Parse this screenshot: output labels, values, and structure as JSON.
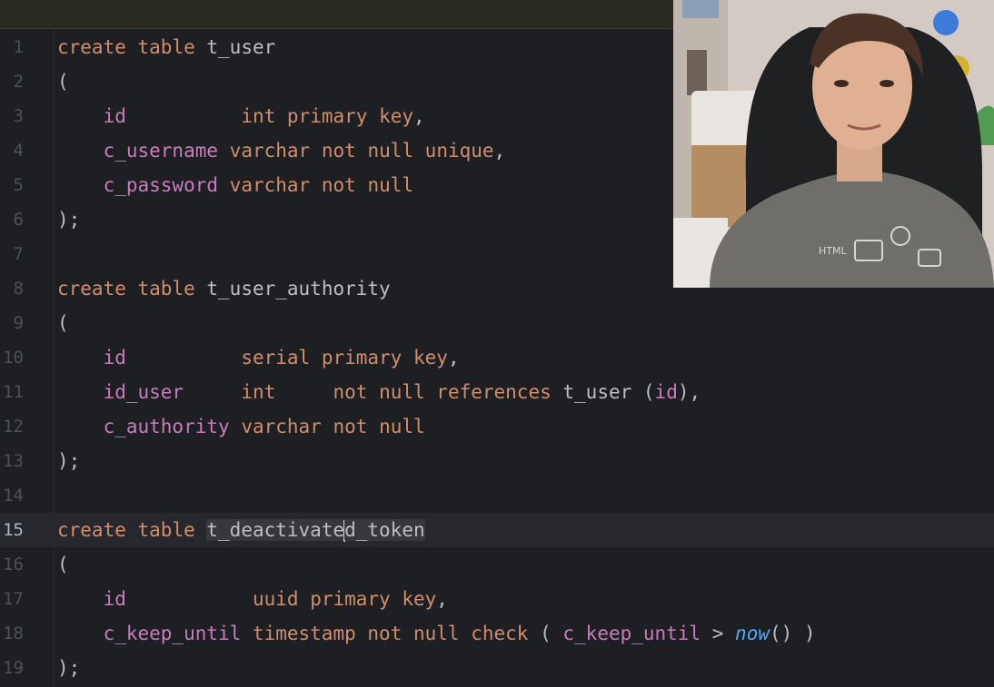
{
  "editor": {
    "current_line": 15,
    "lines": [
      {
        "n": "1",
        "tokens": [
          [
            "kw",
            "create"
          ],
          [
            "pun",
            " "
          ],
          [
            "kw",
            "table"
          ],
          [
            "pun",
            " "
          ],
          [
            "ident",
            "t_user"
          ]
        ]
      },
      {
        "n": "2",
        "tokens": [
          [
            "pun",
            "("
          ]
        ]
      },
      {
        "n": "3",
        "tokens": [
          [
            "pun",
            "    "
          ],
          [
            "fld",
            "id"
          ],
          [
            "pun",
            "          "
          ],
          [
            "kw",
            "int"
          ],
          [
            "pun",
            " "
          ],
          [
            "kw",
            "primary"
          ],
          [
            "pun",
            " "
          ],
          [
            "kw",
            "key"
          ],
          [
            "pun",
            ","
          ]
        ]
      },
      {
        "n": "4",
        "tokens": [
          [
            "pun",
            "    "
          ],
          [
            "fld",
            "c_username"
          ],
          [
            "pun",
            " "
          ],
          [
            "kw",
            "varchar"
          ],
          [
            "pun",
            " "
          ],
          [
            "kw",
            "not"
          ],
          [
            "pun",
            " "
          ],
          [
            "kw",
            "null"
          ],
          [
            "pun",
            " "
          ],
          [
            "kw",
            "unique"
          ],
          [
            "pun",
            ","
          ]
        ]
      },
      {
        "n": "5",
        "tokens": [
          [
            "pun",
            "    "
          ],
          [
            "fld",
            "c_password"
          ],
          [
            "pun",
            " "
          ],
          [
            "kw",
            "varchar"
          ],
          [
            "pun",
            " "
          ],
          [
            "kw",
            "not"
          ],
          [
            "pun",
            " "
          ],
          [
            "kw",
            "null"
          ]
        ]
      },
      {
        "n": "6",
        "tokens": [
          [
            "pun",
            ");"
          ]
        ]
      },
      {
        "n": "7",
        "tokens": []
      },
      {
        "n": "8",
        "tokens": [
          [
            "kw",
            "create"
          ],
          [
            "pun",
            " "
          ],
          [
            "kw",
            "table"
          ],
          [
            "pun",
            " "
          ],
          [
            "ident",
            "t_user_authority"
          ]
        ]
      },
      {
        "n": "9",
        "tokens": [
          [
            "pun",
            "("
          ]
        ]
      },
      {
        "n": "10",
        "tokens": [
          [
            "pun",
            "    "
          ],
          [
            "fld",
            "id"
          ],
          [
            "pun",
            "          "
          ],
          [
            "kw",
            "serial"
          ],
          [
            "pun",
            " "
          ],
          [
            "kw",
            "primary"
          ],
          [
            "pun",
            " "
          ],
          [
            "kw",
            "key"
          ],
          [
            "pun",
            ","
          ]
        ]
      },
      {
        "n": "11",
        "tokens": [
          [
            "pun",
            "    "
          ],
          [
            "fld",
            "id_user"
          ],
          [
            "pun",
            "     "
          ],
          [
            "kw",
            "int"
          ],
          [
            "pun",
            "     "
          ],
          [
            "kw",
            "not"
          ],
          [
            "pun",
            " "
          ],
          [
            "kw",
            "null"
          ],
          [
            "pun",
            " "
          ],
          [
            "kw",
            "references"
          ],
          [
            "pun",
            " "
          ],
          [
            "ident",
            "t_user"
          ],
          [
            "pun",
            " ("
          ],
          [
            "fld",
            "id"
          ],
          [
            "pun",
            "),"
          ]
        ]
      },
      {
        "n": "12",
        "tokens": [
          [
            "pun",
            "    "
          ],
          [
            "fld",
            "c_authority"
          ],
          [
            "pun",
            " "
          ],
          [
            "kw",
            "varchar"
          ],
          [
            "pun",
            " "
          ],
          [
            "kw",
            "not"
          ],
          [
            "pun",
            " "
          ],
          [
            "kw",
            "null"
          ]
        ]
      },
      {
        "n": "13",
        "tokens": [
          [
            "pun",
            ");"
          ]
        ]
      },
      {
        "n": "14",
        "tokens": []
      },
      {
        "n": "15",
        "tokens": [
          [
            "kw",
            "create"
          ],
          [
            "pun",
            " "
          ],
          [
            "kw",
            "table"
          ],
          [
            "pun",
            " "
          ],
          [
            "hl",
            "t_deactivate"
          ],
          [
            "caret",
            ""
          ],
          [
            "hl",
            "d_token"
          ]
        ]
      },
      {
        "n": "16",
        "tokens": [
          [
            "pun",
            "("
          ]
        ]
      },
      {
        "n": "17",
        "tokens": [
          [
            "pun",
            "    "
          ],
          [
            "fld",
            "id"
          ],
          [
            "pun",
            "           "
          ],
          [
            "kw",
            "uuid"
          ],
          [
            "pun",
            " "
          ],
          [
            "kw",
            "primary"
          ],
          [
            "pun",
            " "
          ],
          [
            "kw",
            "key"
          ],
          [
            "pun",
            ","
          ]
        ]
      },
      {
        "n": "18",
        "tokens": [
          [
            "pun",
            "    "
          ],
          [
            "fld",
            "c_keep_until"
          ],
          [
            "pun",
            " "
          ],
          [
            "kw",
            "timestamp"
          ],
          [
            "pun",
            " "
          ],
          [
            "kw",
            "not"
          ],
          [
            "pun",
            " "
          ],
          [
            "kw",
            "null"
          ],
          [
            "pun",
            " "
          ],
          [
            "kw",
            "check"
          ],
          [
            "pun",
            " ( "
          ],
          [
            "fld",
            "c_keep_until"
          ],
          [
            "pun",
            " > "
          ],
          [
            "fn",
            "now"
          ],
          [
            "pun",
            "() )"
          ]
        ]
      },
      {
        "n": "19",
        "tokens": [
          [
            "pun",
            ");"
          ]
        ]
      }
    ]
  },
  "colors": {
    "keyword": "#cf8e6d",
    "field": "#c77dbb",
    "function": "#56a8f5",
    "text": "#bcbec4",
    "background": "#1e1f22"
  },
  "webcam": {
    "shirt_text": "HTML"
  }
}
